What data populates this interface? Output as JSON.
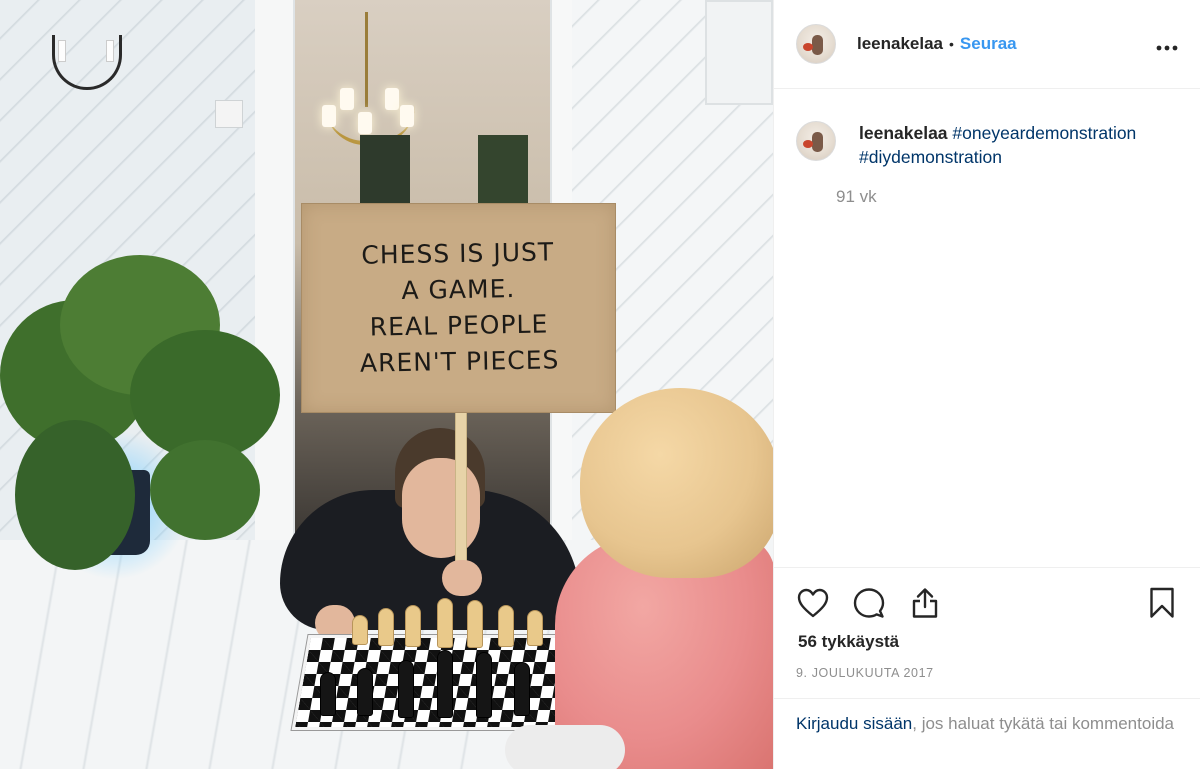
{
  "photo": {
    "sign_text": "CHESS IS JUST\nA GAME.\nREAL PEOPLE\nAREN'T PIECES"
  },
  "header": {
    "username": "leenakelaa",
    "separator": "•",
    "follow_label": "Seuraa",
    "more_icon": "more-horizontal-icon"
  },
  "caption": {
    "username": "leenakelaa",
    "hashtags": [
      "#oneyeardemonstration",
      "#diydemonstration"
    ],
    "time": "91 vk"
  },
  "actions": {
    "icons": [
      "heart-icon",
      "comment-icon",
      "share-icon",
      "bookmark-icon"
    ],
    "likes": "56 tykkäystä",
    "date": "9. JOULUKUUTA 2017"
  },
  "login": {
    "link": "Kirjaudu sisään",
    "rest": ", jos haluat tykätä tai kommentoida"
  },
  "colors": {
    "follow": "#3897f0",
    "hashtag": "#003569",
    "muted": "#8e8e8e",
    "text": "#262626"
  }
}
